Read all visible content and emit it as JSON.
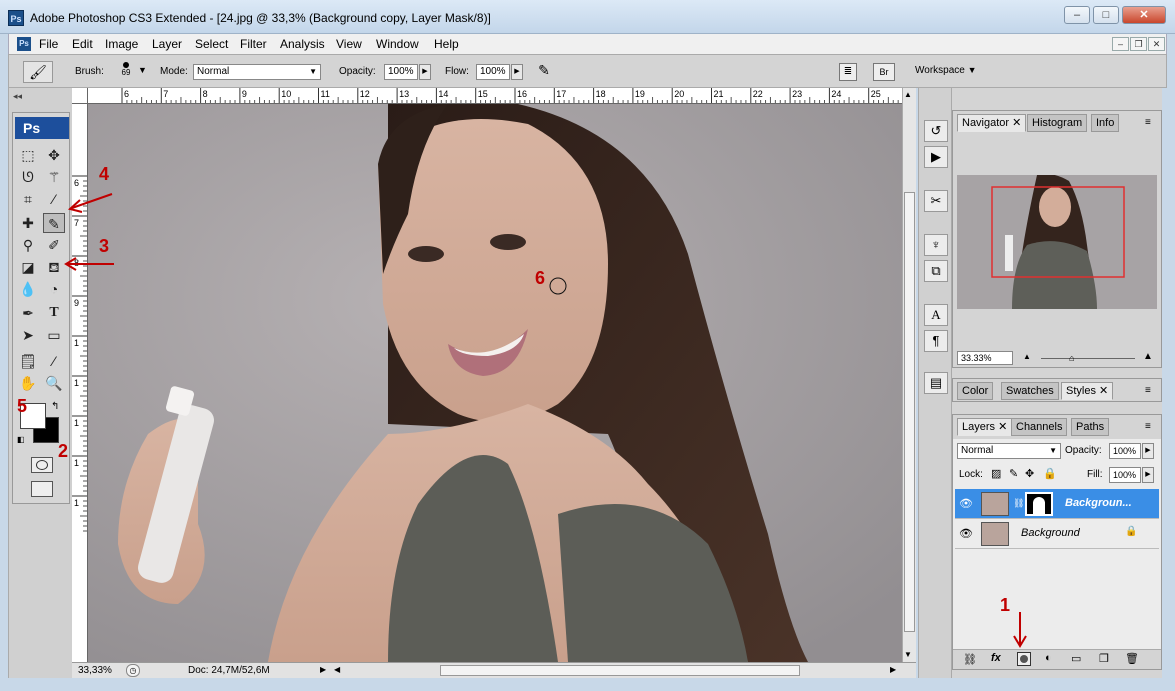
{
  "window": {
    "title": "Adobe Photoshop CS3 Extended - [24.jpg @ 33,3% (Background copy, Layer Mask/8)]",
    "app_icon": "Ps"
  },
  "menu": [
    "File",
    "Edit",
    "Image",
    "Layer",
    "Select",
    "Filter",
    "Analysis",
    "View",
    "Window",
    "Help"
  ],
  "options": {
    "brush_label": "Brush:",
    "brush_size": "69",
    "mode_label": "Mode:",
    "mode_value": "Normal",
    "opacity_label": "Opacity:",
    "opacity_value": "100%",
    "flow_label": "Flow:",
    "flow_value": "100%",
    "workspace_label": "Workspace"
  },
  "toolbox": {
    "logo": "Ps"
  },
  "ruler_top_labels": [
    "6",
    "7",
    "8",
    "9",
    "10",
    "11",
    "12",
    "13",
    "14",
    "15",
    "16",
    "17",
    "18",
    "19",
    "20",
    "21",
    "22",
    "23",
    "24",
    "25"
  ],
  "ruler_left_labels": [
    "6",
    "7",
    "8",
    "9",
    "1",
    "1",
    "1",
    "1",
    "1"
  ],
  "status": {
    "zoom": "33,33%",
    "doc": "Doc: 24,7M/52,6M"
  },
  "navigator": {
    "tabs": [
      "Navigator",
      "Histogram",
      "Info"
    ],
    "zoom": "33.33%"
  },
  "styles_panel": {
    "tabs": [
      "Color",
      "Swatches",
      "Styles"
    ]
  },
  "layers_panel": {
    "tabs": [
      "Layers",
      "Channels",
      "Paths"
    ],
    "blend_mode": "Normal",
    "opacity_label": "Opacity:",
    "opacity_value": "100%",
    "lock_label": "Lock:",
    "fill_label": "Fill:",
    "fill_value": "100%",
    "layers": [
      {
        "name": "Backgroun...",
        "selected": true
      },
      {
        "name": "Background",
        "selected": false
      }
    ]
  },
  "annotations": {
    "n1": "1",
    "n2": "2",
    "n3": "3",
    "n4": "4",
    "n5": "5",
    "n6": "6"
  },
  "colors": {
    "accent": "#3a8ee6",
    "annotation": "#c00000",
    "toolbox_logo": "#1d4f9c"
  }
}
